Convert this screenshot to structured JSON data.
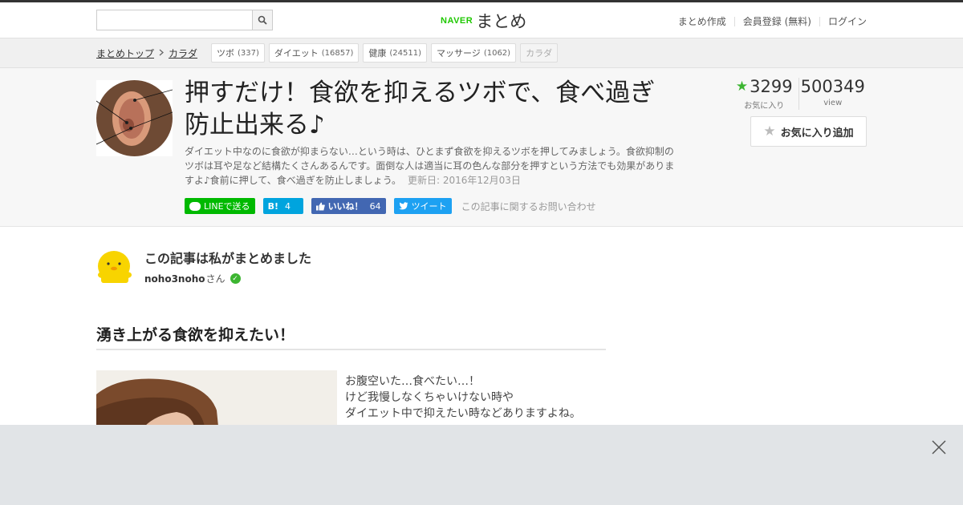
{
  "topbar": {
    "search_placeholder": "",
    "brand_naver": "NAVER",
    "brand_matome": "まとめ",
    "nav": [
      "まとめ作成",
      "会員登録 (無料)",
      "ログイン"
    ]
  },
  "breadcrumb": {
    "home": "まとめトップ",
    "category": "カラダ"
  },
  "tags": [
    {
      "label": "ツボ",
      "count": "(337)"
    },
    {
      "label": "ダイエット",
      "count": "(16857)"
    },
    {
      "label": "健康",
      "count": "(24511)"
    },
    {
      "label": "マッサージ",
      "count": "(1062)"
    },
    {
      "label": "カラダ",
      "count": ""
    }
  ],
  "article": {
    "title": "押すだけ！食欲を抑えるツボで、食べ過ぎ防止出来る♪",
    "description": "ダイエット中なのに食欲が抑まらない…という時は、ひとまず食欲を抑えるツボを押してみましょう。食欲抑制のツボは耳や足など結構たくさんあるんです。面倒な人は適当に耳の色んな部分を押すという方法でも効果がありますよ♪食前に押して、食べ過ぎを防止しましょう。",
    "updated": "更新日: 2016年12月03日"
  },
  "share": {
    "line": "LINEで送る",
    "hatena_icon": "B!",
    "hatena_count": "4",
    "fb_label": "いいね！",
    "fb_count": "64",
    "tweet": "ツイート",
    "inquiry": "この記事に関するお問い合わせ"
  },
  "stats": {
    "favorites": "3299",
    "favorites_label": "お気に入り",
    "views": "500349",
    "views_label": "view"
  },
  "fav_button": "お気に入り追加",
  "author": {
    "heading": "この記事は私がまとめました",
    "name": "noho3noho",
    "suffix": "さん"
  },
  "section": {
    "heading": "湧き上がる食欲を抑えたい！",
    "lines": [
      "お腹空いた…食べたい…！",
      "けど我慢しなくちゃいけない時や",
      "ダイエット中で抑えたい時などありますよね。"
    ]
  },
  "colors": {
    "naver_green": "#1ec800",
    "star_green": "#3cb531",
    "line": "#00b900",
    "hatena": "#00a4de",
    "facebook": "#4267b2",
    "twitter": "#1da1f2"
  },
  "icons": [
    "search-icon",
    "chevron-right-icon",
    "star-icon",
    "check-icon",
    "close-icon",
    "line-icon",
    "facebook-like-icon",
    "twitter-icon"
  ]
}
